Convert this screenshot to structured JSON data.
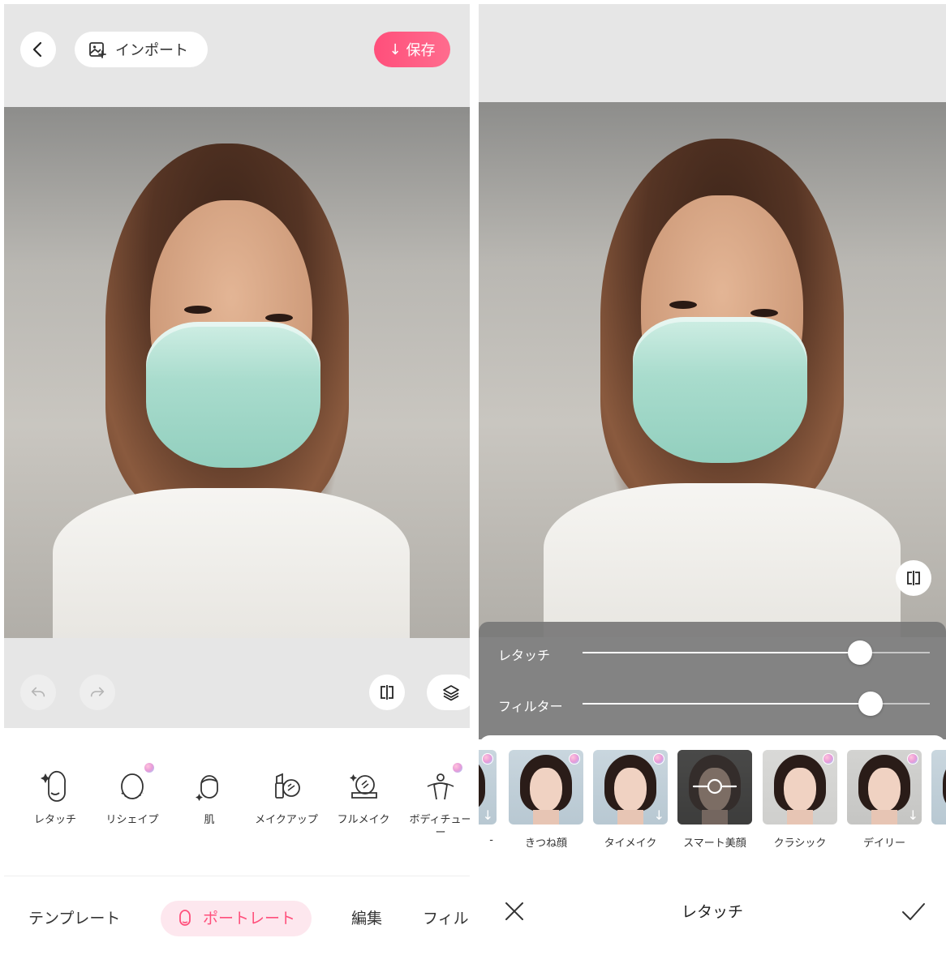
{
  "left": {
    "header": {
      "import_label": "インポート",
      "save_label": "保存"
    },
    "tools": [
      {
        "label": "レタッチ",
        "premium": false
      },
      {
        "label": "リシェイプ",
        "premium": true
      },
      {
        "label": "肌",
        "premium": false
      },
      {
        "label": "メイクアップ",
        "premium": false
      },
      {
        "label": "フルメイク",
        "premium": false
      },
      {
        "label": "ボディチュー\nー",
        "premium": true
      }
    ],
    "bottom_tabs": [
      {
        "label": "テンプレート",
        "active": false
      },
      {
        "label": "ポートレート",
        "active": true
      },
      {
        "label": "編集",
        "active": false
      },
      {
        "label": "フィル",
        "active": false
      }
    ]
  },
  "right": {
    "sliders": [
      {
        "label": "レタッチ",
        "value": 0.8
      },
      {
        "label": "フィルター",
        "value": 0.83
      }
    ],
    "presets": [
      {
        "label": "-",
        "downloadable": true,
        "premium": true,
        "partial": true
      },
      {
        "label": "きつね顔",
        "downloadable": false,
        "premium": true
      },
      {
        "label": "タイメイク",
        "downloadable": true,
        "premium": true
      },
      {
        "label": "スマート美顔",
        "downloadable": false,
        "premium": false,
        "smart": true
      },
      {
        "label": "クラシック",
        "downloadable": false,
        "premium": true
      },
      {
        "label": "デイリー",
        "downloadable": true,
        "premium": true
      }
    ],
    "footer_title": "レタッチ"
  }
}
